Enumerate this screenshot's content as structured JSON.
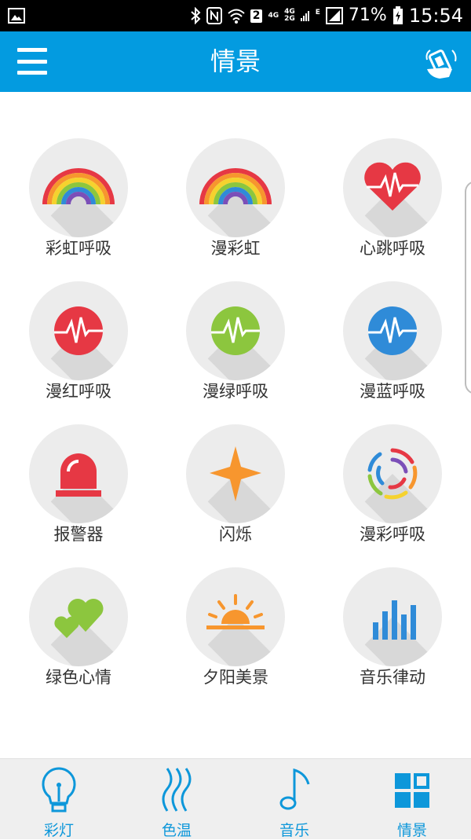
{
  "status_bar": {
    "network_1": "4G",
    "network_2": "4G",
    "network_3": "2G",
    "network_e": "E",
    "sim_slot": "2",
    "battery": "71%",
    "time": "15:54",
    "icons": [
      "gallery-icon",
      "bluetooth-icon",
      "nfc-icon",
      "wifi-icon",
      "signal-icon",
      "battery-icon"
    ]
  },
  "app_bar": {
    "title": "情景",
    "menu_icon": "hamburger-menu-icon",
    "action_icon": "shake-phone-icon"
  },
  "colors": {
    "primary": "#039be0",
    "red": "#e63844",
    "green": "#8cc63e",
    "blue": "#2f8bd8",
    "orange": "#f7962e",
    "tab_blue": "#0d97da",
    "circle_bg": "#ececec"
  },
  "scenes": [
    {
      "label": "彩虹呼吸",
      "icon": "rainbow-icon"
    },
    {
      "label": "漫彩虹",
      "icon": "rainbow-icon"
    },
    {
      "label": "心跳呼吸",
      "icon": "heartbeat-icon"
    },
    {
      "label": "漫红呼吸",
      "icon": "pulse-red-icon"
    },
    {
      "label": "漫绿呼吸",
      "icon": "pulse-green-icon"
    },
    {
      "label": "漫蓝呼吸",
      "icon": "pulse-blue-icon"
    },
    {
      "label": "报警器",
      "icon": "alarm-siren-icon"
    },
    {
      "label": "闪烁",
      "icon": "flash-star-icon"
    },
    {
      "label": "漫彩呼吸",
      "icon": "color-swirl-icon"
    },
    {
      "label": "绿色心情",
      "icon": "green-hearts-icon"
    },
    {
      "label": "夕阳美景",
      "icon": "sunset-icon"
    },
    {
      "label": "音乐律动",
      "icon": "music-bars-icon"
    }
  ],
  "bottom_nav": [
    {
      "label": "彩灯",
      "icon": "lightbulb-icon"
    },
    {
      "label": "色温",
      "icon": "heat-waves-icon"
    },
    {
      "label": "音乐",
      "icon": "music-note-icon"
    },
    {
      "label": "情景",
      "icon": "grid-scene-icon",
      "active": true
    }
  ]
}
